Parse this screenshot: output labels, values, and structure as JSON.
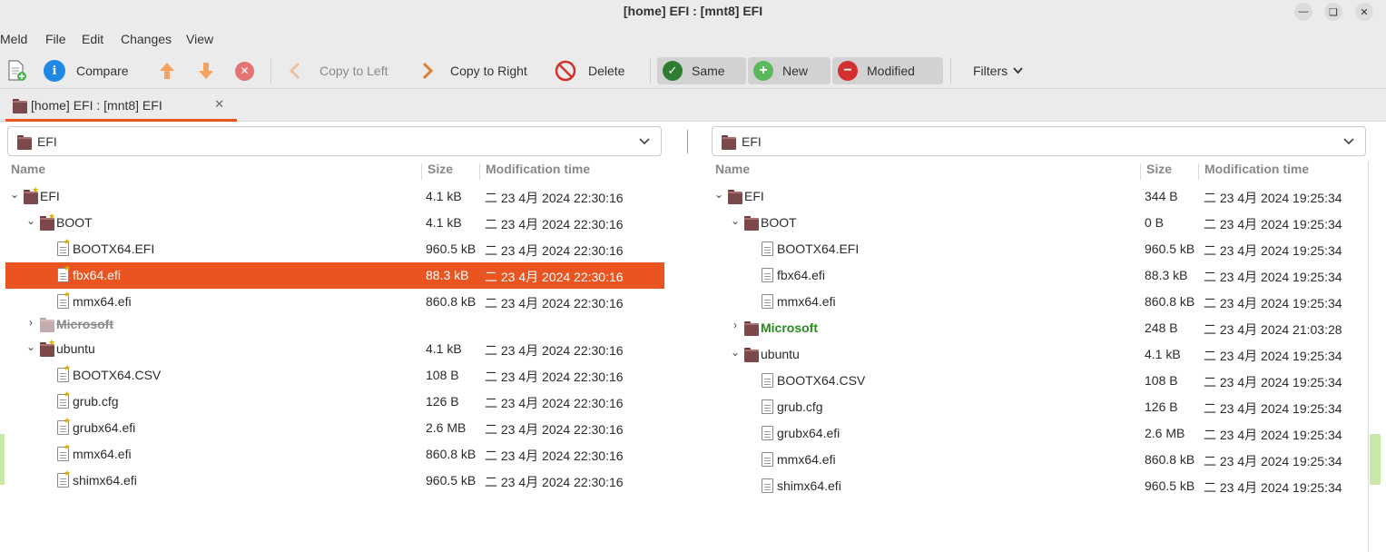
{
  "window": {
    "title": "[home] EFI : [mnt8] EFI"
  },
  "menubar": [
    "Meld",
    "File",
    "Edit",
    "Changes",
    "View"
  ],
  "toolbar": {
    "compare": "Compare",
    "copy_left": "Copy to Left",
    "copy_right": "Copy to Right",
    "delete": "Delete",
    "same": "Same",
    "new": "New",
    "modified": "Modified",
    "filters": "Filters"
  },
  "tab": {
    "label": "[home] EFI : [mnt8] EFI"
  },
  "left": {
    "location": "EFI",
    "columns": {
      "name": "Name",
      "size": "Size",
      "mtime": "Modification time"
    },
    "rows": [
      {
        "name": "EFI",
        "size": "4.1 kB",
        "mtime": "二 23 4月 2024 22:30:16"
      },
      {
        "name": "BOOT",
        "size": "4.1 kB",
        "mtime": "二 23 4月 2024 22:30:16"
      },
      {
        "name": "BOOTX64.EFI",
        "size": "960.5 kB",
        "mtime": "二 23 4月 2024 22:30:16"
      },
      {
        "name": "fbx64.efi",
        "size": "88.3 kB",
        "mtime": "二 23 4月 2024 22:30:16"
      },
      {
        "name": "mmx64.efi",
        "size": "860.8 kB",
        "mtime": "二 23 4月 2024 22:30:16"
      },
      {
        "name": "Microsoft",
        "size": "",
        "mtime": ""
      },
      {
        "name": "ubuntu",
        "size": "4.1 kB",
        "mtime": "二 23 4月 2024 22:30:16"
      },
      {
        "name": "BOOTX64.CSV",
        "size": "108 B",
        "mtime": "二 23 4月 2024 22:30:16"
      },
      {
        "name": "grub.cfg",
        "size": "126 B",
        "mtime": "二 23 4月 2024 22:30:16"
      },
      {
        "name": "grubx64.efi",
        "size": "2.6 MB",
        "mtime": "二 23 4月 2024 22:30:16"
      },
      {
        "name": "mmx64.efi",
        "size": "860.8 kB",
        "mtime": "二 23 4月 2024 22:30:16"
      },
      {
        "name": "shimx64.efi",
        "size": "960.5 kB",
        "mtime": "二 23 4月 2024 22:30:16"
      }
    ]
  },
  "right": {
    "location": "EFI",
    "columns": {
      "name": "Name",
      "size": "Size",
      "mtime": "Modification time"
    },
    "rows": [
      {
        "name": "EFI",
        "size": "344 B",
        "mtime": "二 23 4月 2024 19:25:34"
      },
      {
        "name": "BOOT",
        "size": "0 B",
        "mtime": "二 23 4月 2024 19:25:34"
      },
      {
        "name": "BOOTX64.EFI",
        "size": "960.5 kB",
        "mtime": "二 23 4月 2024 19:25:34"
      },
      {
        "name": "fbx64.efi",
        "size": "88.3 kB",
        "mtime": "二 23 4月 2024 19:25:34"
      },
      {
        "name": "mmx64.efi",
        "size": "860.8 kB",
        "mtime": "二 23 4月 2024 19:25:34"
      },
      {
        "name": "Microsoft",
        "size": "248 B",
        "mtime": "二 23 4月 2024 21:03:28"
      },
      {
        "name": "ubuntu",
        "size": "4.1 kB",
        "mtime": "二 23 4月 2024 19:25:34"
      },
      {
        "name": "BOOTX64.CSV",
        "size": "108 B",
        "mtime": "二 23 4月 2024 19:25:34"
      },
      {
        "name": "grub.cfg",
        "size": "126 B",
        "mtime": "二 23 4月 2024 19:25:34"
      },
      {
        "name": "grubx64.efi",
        "size": "2.6 MB",
        "mtime": "二 23 4月 2024 19:25:34"
      },
      {
        "name": "mmx64.efi",
        "size": "860.8 kB",
        "mtime": "二 23 4月 2024 19:25:34"
      },
      {
        "name": "shimx64.efi",
        "size": "960.5 kB",
        "mtime": "二 23 4月 2024 19:25:34"
      }
    ]
  },
  "colors": {
    "accent": "#e95420",
    "same": "#2e7d32",
    "new": "#5cb85c",
    "modified": "#d32f2f",
    "compare": "#1e88e5",
    "new_text": "#2b8a1f"
  }
}
